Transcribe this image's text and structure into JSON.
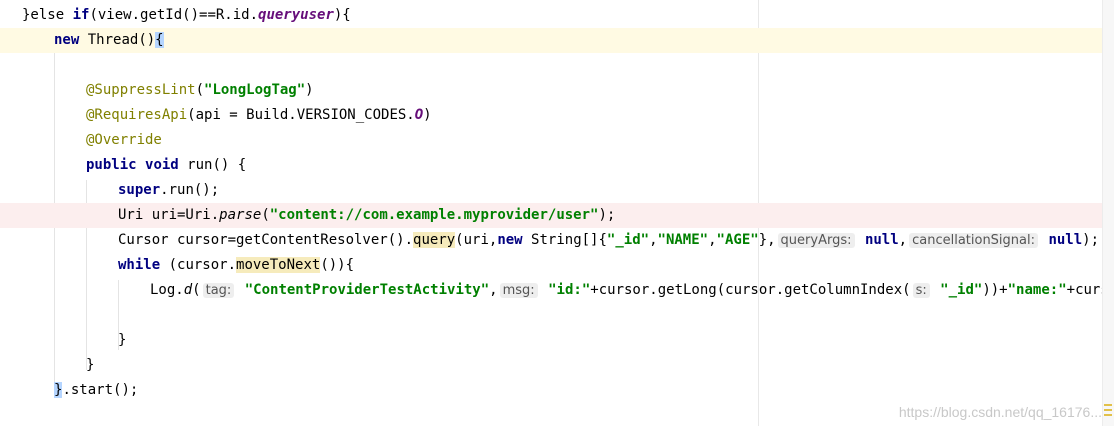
{
  "editor": {
    "lines": [
      {
        "parts": [
          "}else ",
          "if",
          "(view.getId()==R.id.",
          "queryuser",
          "){"
        ]
      },
      {
        "parts": [
          "new",
          " Thread",
          "()",
          "{"
        ]
      },
      {
        "parts": []
      },
      {
        "parts": [
          "@SuppressLint",
          "(",
          "\"LongLogTag\"",
          ")"
        ]
      },
      {
        "parts": [
          "@RequiresApi",
          "(api = Build.VERSION_CODES.",
          "O",
          ")"
        ]
      },
      {
        "parts": [
          "@Override"
        ]
      },
      {
        "parts": [
          "public",
          " ",
          "void",
          " run() {"
        ]
      },
      {
        "parts": [
          "super",
          ".run();"
        ]
      },
      {
        "parts": [
          "Uri uri=Uri.",
          "parse",
          "(",
          "\"content://com.example.myprovider/user\"",
          ");"
        ]
      },
      {
        "parts": [
          "Cursor cursor=getContentResolver().",
          "query",
          "(uri,",
          "new",
          " String[]{",
          "\"_id\"",
          ",",
          "\"NAME\"",
          ",",
          "\"AGE\"",
          "},",
          "queryArgs:",
          " ",
          "null",
          ",",
          "cancellationSignal:",
          " ",
          "null",
          ");"
        ]
      },
      {
        "parts": [
          "while",
          " (cursor.",
          "moveToNext",
          "()){"
        ]
      },
      {
        "parts": [
          "Log.",
          "d",
          "(",
          "tag:",
          " ",
          "\"ContentProviderTestActivity\"",
          ",",
          "msg:",
          " ",
          "\"id:\"",
          "+cursor.getLong(cursor.getColumnIndex(",
          "s:",
          " ",
          "\"_id\"",
          "))+",
          "\"name:\"",
          "+curs"
        ]
      },
      {
        "parts": []
      },
      {
        "parts": [
          "}"
        ]
      },
      {
        "parts": [
          "}"
        ]
      },
      {
        "parts": [
          "}",
          ".start();"
        ]
      }
    ]
  },
  "colors": {
    "keyword": "#000080",
    "annotation": "#808000",
    "string": "#008000",
    "field": "#660e7a",
    "caret_line": "#fffae3",
    "error_line": "#fceeee"
  },
  "watermark": "https://blog.csdn.net/qq_16176..."
}
